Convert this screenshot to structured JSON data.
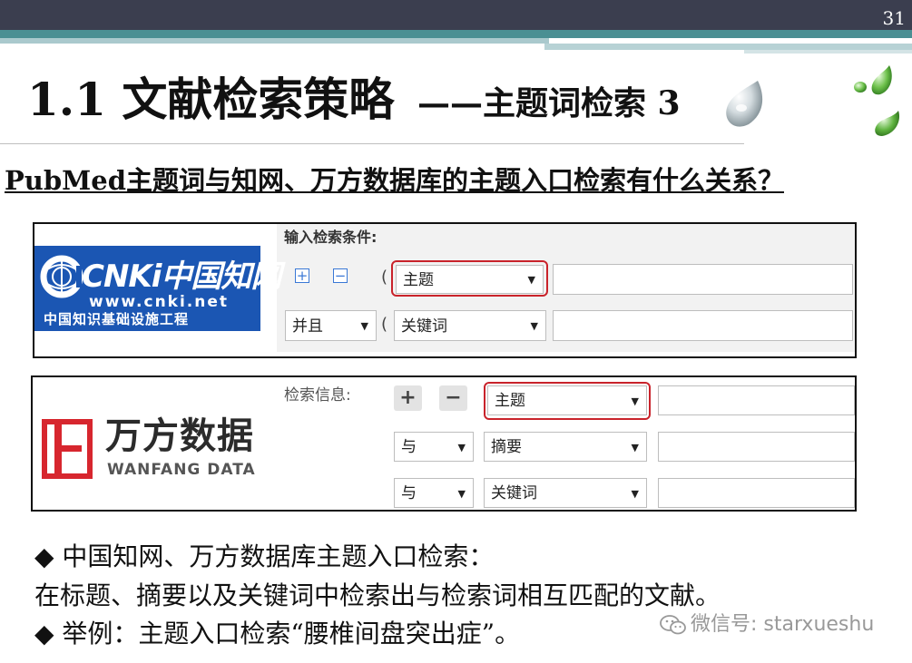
{
  "slide": {
    "page_number": "31",
    "title_main": "1.1 文献检索策略",
    "title_sub": "——主题词检索 3",
    "question": "PubMed主题词与知网、万方数据库的主题入口检索有什么关系？"
  },
  "cnki": {
    "logo_brand": "CNKi中国知网",
    "logo_url": "www.cnki.net",
    "logo_subtitle": "中国知识基础设施工程",
    "form_label": "输入检索条件:",
    "plus_icon": "+",
    "minus_icon": "−",
    "paren": "(",
    "row1_field": "主题",
    "row2_logic": "并且",
    "row2_field": "关键词",
    "arrow": "▼"
  },
  "wanfang": {
    "logo_cn": "万方数据",
    "logo_en": "WANFANG DATA",
    "form_label": "检索信息:",
    "plus_icon": "+",
    "minus_icon": "−",
    "row1_field": "主题",
    "row2_logic": "与",
    "row2_field": "摘要",
    "row3_logic": "与",
    "row3_field": "关键词",
    "arrow": "▼"
  },
  "body": {
    "line1": "◆ 中国知网、万方数据库主题入口检索：",
    "line2": "在标题、摘要以及关键词中检索出与检索词相互匹配的文献。",
    "line3": "◆ 举例：主题入口检索“腰椎间盘突出症”。"
  },
  "watermark": "微信号: starxueshu",
  "colors": {
    "header_dark": "#3b3e4f",
    "header_teal": "#4b8f93",
    "cnki_blue": "#1b56b3",
    "wanfang_red": "#d7262e",
    "highlight_red": "#c9232b"
  }
}
